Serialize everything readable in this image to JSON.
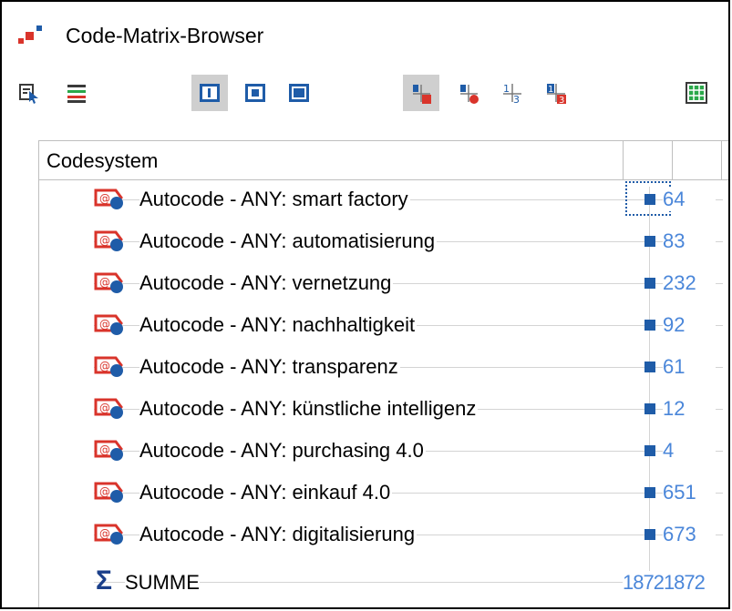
{
  "window": {
    "title": "Code-Matrix-Browser"
  },
  "toolbar": {
    "buttons": [
      {
        "icon": "select-documents-icon"
      },
      {
        "icon": "select-codes-icon"
      },
      {
        "icon": "layout-narrow-icon",
        "pressed": true
      },
      {
        "icon": "layout-medium-icon",
        "pressed": false
      },
      {
        "icon": "layout-wide-icon",
        "pressed": false
      },
      {
        "icon": "symbols-squares-icon",
        "pressed": true
      },
      {
        "icon": "symbols-circles-icon",
        "pressed": false
      },
      {
        "icon": "numbers-icon",
        "pressed": false
      },
      {
        "icon": "colored-numbers-icon",
        "pressed": false
      },
      {
        "icon": "grid-table-icon",
        "pressed": false
      }
    ]
  },
  "matrix": {
    "header": "Codesystem",
    "rows": [
      {
        "label": "Autocode - ANY: smart factory",
        "value": "64"
      },
      {
        "label": "Autocode - ANY: automatisierung",
        "value": "83"
      },
      {
        "label": "Autocode - ANY: vernetzung",
        "value": "232"
      },
      {
        "label": "Autocode - ANY: nachhaltigkeit",
        "value": "92"
      },
      {
        "label": "Autocode - ANY: transparenz",
        "value": "61"
      },
      {
        "label": "Autocode - ANY: künstliche intelligenz",
        "value": "12"
      },
      {
        "label": "Autocode - ANY: purchasing 4.0",
        "value": "4"
      },
      {
        "label": "Autocode - ANY: einkauf 4.0",
        "value": "651"
      },
      {
        "label": "Autocode - ANY: digitalisierung",
        "value": "673"
      }
    ],
    "sum": {
      "symbol": "Σ",
      "label": "SUMME",
      "value": "18721872"
    }
  },
  "colors": {
    "accent": "#1f5ca8",
    "value_text": "#4a86d9",
    "code_icon_red": "#d9342b"
  }
}
